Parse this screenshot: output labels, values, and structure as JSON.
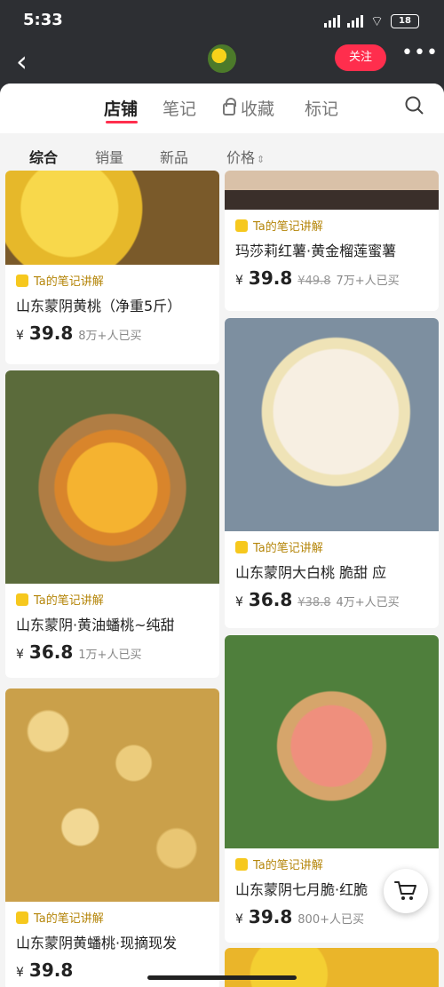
{
  "status": {
    "time": "5:33",
    "battery": "18"
  },
  "header": {
    "follow_label": "关注"
  },
  "tabs": [
    {
      "label": "店铺"
    },
    {
      "label": "笔记"
    },
    {
      "label": "收藏"
    },
    {
      "label": "标记"
    }
  ],
  "filters": [
    {
      "label": "综合"
    },
    {
      "label": "销量"
    },
    {
      "label": "新品"
    },
    {
      "label": "价格"
    }
  ],
  "badge_label": "Ta的笔记讲解",
  "products": [
    {
      "title": "山东蒙阴黄桃（净重5斤）",
      "currency": "¥",
      "price": "39.8",
      "sold": "8万+人已买"
    },
    {
      "title": "山东蒙阴·黄油蟠桃~纯甜",
      "currency": "¥",
      "price": "36.8",
      "sold": "1万+人已买"
    },
    {
      "title": "山东蒙阴黄蟠桃·现摘现发",
      "currency": "¥",
      "price": "39.8"
    },
    {
      "title": "玛莎莉红薯·黄金榴莲蜜薯",
      "currency": "¥",
      "price": "39.8",
      "original": "49.8",
      "sold": "7万+人已买"
    },
    {
      "title": "山东蒙阴大白桃 脆甜 应",
      "currency": "¥",
      "price": "36.8",
      "original": "38.8",
      "sold": "4万+人已买"
    },
    {
      "title": "山东蒙阴七月脆·红脆",
      "currency": "¥",
      "price": "39.8",
      "sold": "800+人已买"
    }
  ],
  "icons": {
    "back": "back-arrow-icon",
    "more": "more-icon",
    "lock": "lock-icon",
    "search": "search-icon",
    "sort": "sort-icon",
    "cart": "cart-icon"
  },
  "colors": {
    "accent": "#ff2e4d",
    "badge": "#b5860b",
    "header_bg": "#2d2f33"
  }
}
